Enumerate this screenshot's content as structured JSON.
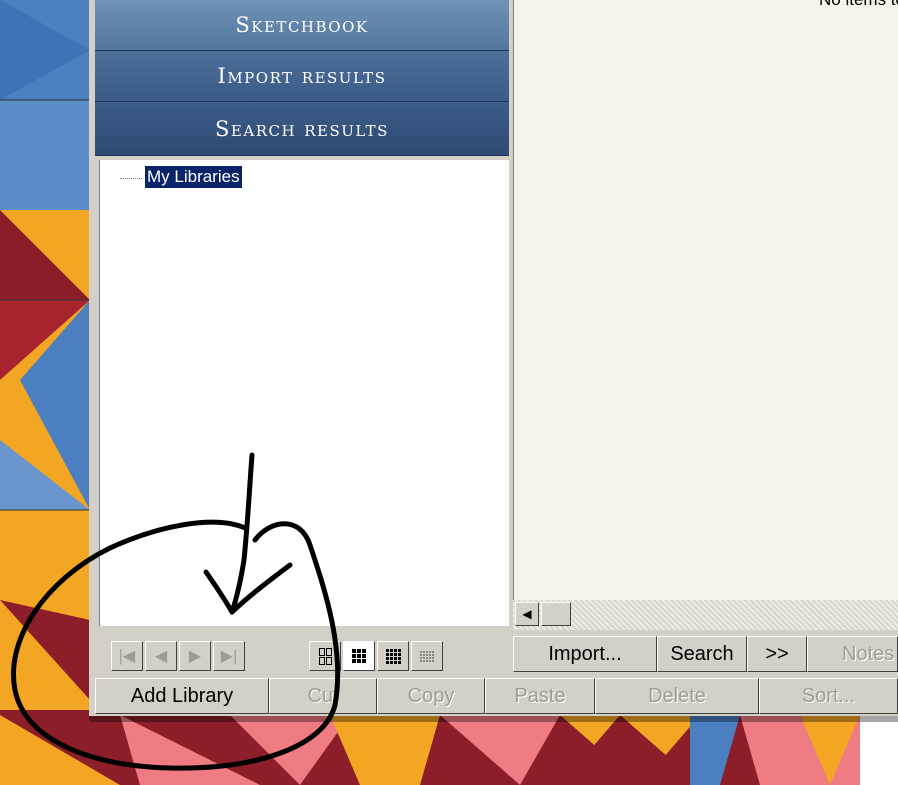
{
  "nav": {
    "sketchbook": "Sketchbook",
    "import_results": "Import results",
    "search_results": "Search results"
  },
  "tree": {
    "root": "My Libraries"
  },
  "content": {
    "empty_message": "No items to"
  },
  "toolbar": {
    "import": "Import...",
    "search": "Search",
    "more": ">>",
    "notes": "Notes",
    "add_library": "Add Library",
    "cut": "Cut",
    "copy": "Copy",
    "paste": "Paste",
    "delete": "Delete",
    "sort": "Sort..."
  },
  "icons": {
    "first": "first-page-icon",
    "prev": "previous-page-icon",
    "next": "next-page-icon",
    "last": "last-page-icon",
    "grid_2x2": "grid-2x2-icon",
    "grid_3x3": "grid-3x3-icon",
    "grid_4x4": "grid-4x4-icon",
    "grid_5x5": "grid-5x5-icon"
  },
  "colors": {
    "selection": "#0a246a",
    "nav_blue": "#3b5b86",
    "window_face": "#d4d0c8",
    "quilt_blue": "#4c7fbf",
    "quilt_gold": "#f2a623",
    "quilt_maroon": "#8b1e28",
    "quilt_pink": "#ef7b83"
  }
}
